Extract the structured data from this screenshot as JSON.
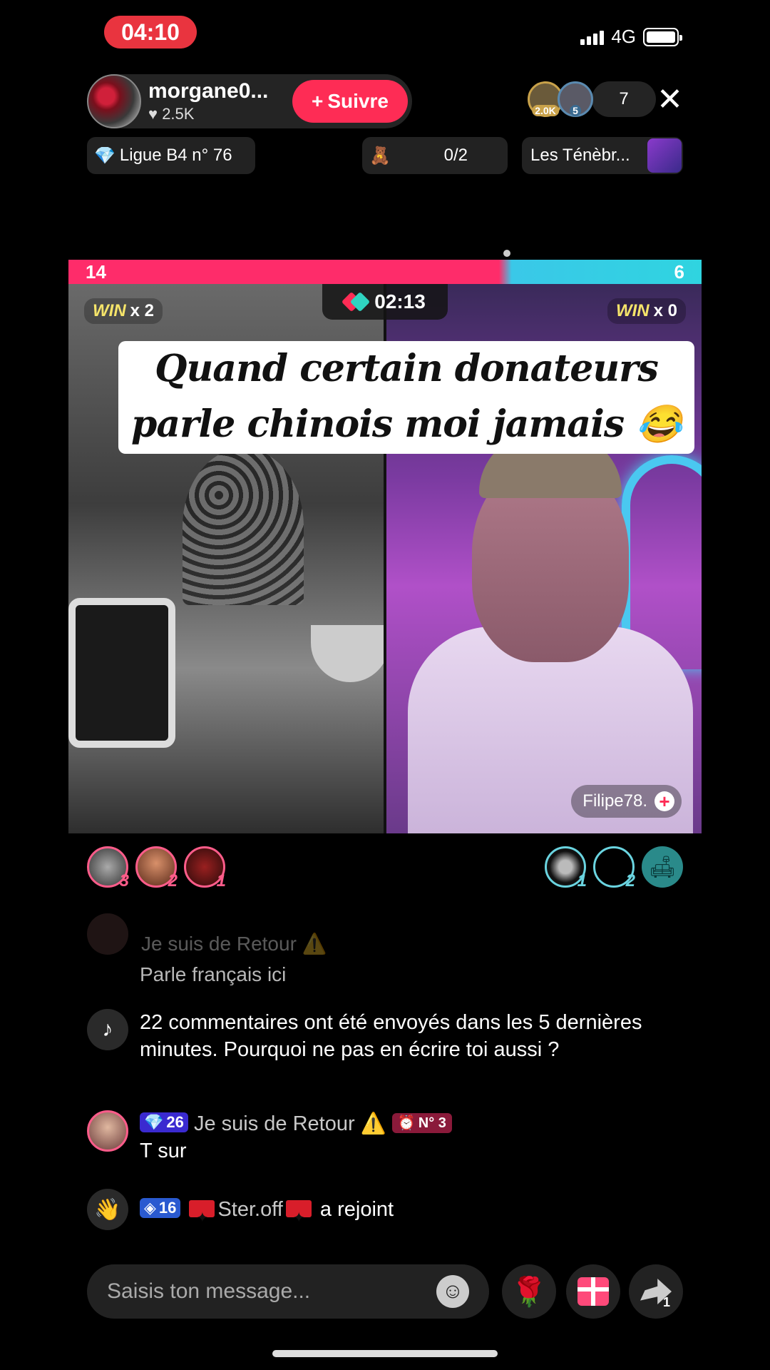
{
  "status_bar": {
    "time": "04:10",
    "network": "4G"
  },
  "host": {
    "name": "morgane0...",
    "likes": "2.5K",
    "follow_label": "Suivre"
  },
  "viewers": {
    "top1_badge": "2.0K",
    "top2_badge": "5",
    "count": "7"
  },
  "badges": {
    "league": "Ligue B4 n° 76",
    "goal_progress": "0/2",
    "partner_name": "Les Ténèbr..."
  },
  "battle": {
    "score_left": "14",
    "score_right": "6",
    "timer": "02:13",
    "win_left_label": "WIN",
    "win_left_count": "x 2",
    "win_right_label": "WIN",
    "win_right_count": "x 0",
    "caption_line1": "Quand certain donateurs",
    "caption_line2": "parle chinois moi jamais 😂",
    "opponent_name": "Filipe78.",
    "progress_left_fraction": 0.7
  },
  "supporters": {
    "left_ranks": [
      "3",
      "2",
      "1"
    ],
    "right_ranks": [
      "1",
      "2"
    ]
  },
  "chat": {
    "faded_user": "Je suis de Retour ⚠️",
    "faded_text": "Parle français ici",
    "system_msg": "22 commentaires ont été envoyés dans les 5 dernières minutes. Pourquoi ne pas en écrire toi aussi ?",
    "msg_user_level": "26",
    "msg_user_name": "Je suis de Retour ⚠️",
    "msg_user_rank": "N° 3",
    "msg_text": "T sur",
    "join_level": "16",
    "join_name": "Ster.off",
    "join_text": "a rejoint"
  },
  "input": {
    "placeholder": "Saisis ton message...",
    "share_count": "1"
  }
}
